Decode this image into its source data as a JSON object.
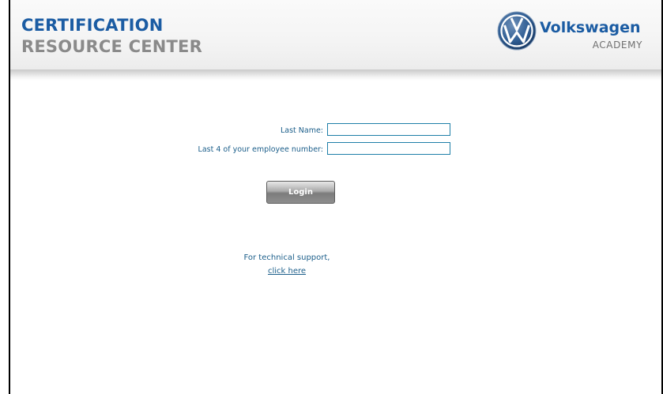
{
  "header": {
    "title_line1": "CERTIFICATION",
    "title_line2": "RESOURCE CENTER",
    "brand_name": "Volkswagen",
    "brand_sub": "ACADEMY",
    "logo_icon": "vw-logo-icon"
  },
  "form": {
    "last_name_label": "Last Name:",
    "last_name_value": "",
    "employee_label": "Last 4 of your employee number:",
    "employee_value": "",
    "login_label": "Login"
  },
  "support": {
    "text": "For technical support,",
    "link_text": "click here"
  },
  "colors": {
    "title_blue": "#1b5ca3",
    "title_gray": "#8a8a8a",
    "label_blue": "#1b5e8a",
    "field_border": "#1e7fa8"
  }
}
